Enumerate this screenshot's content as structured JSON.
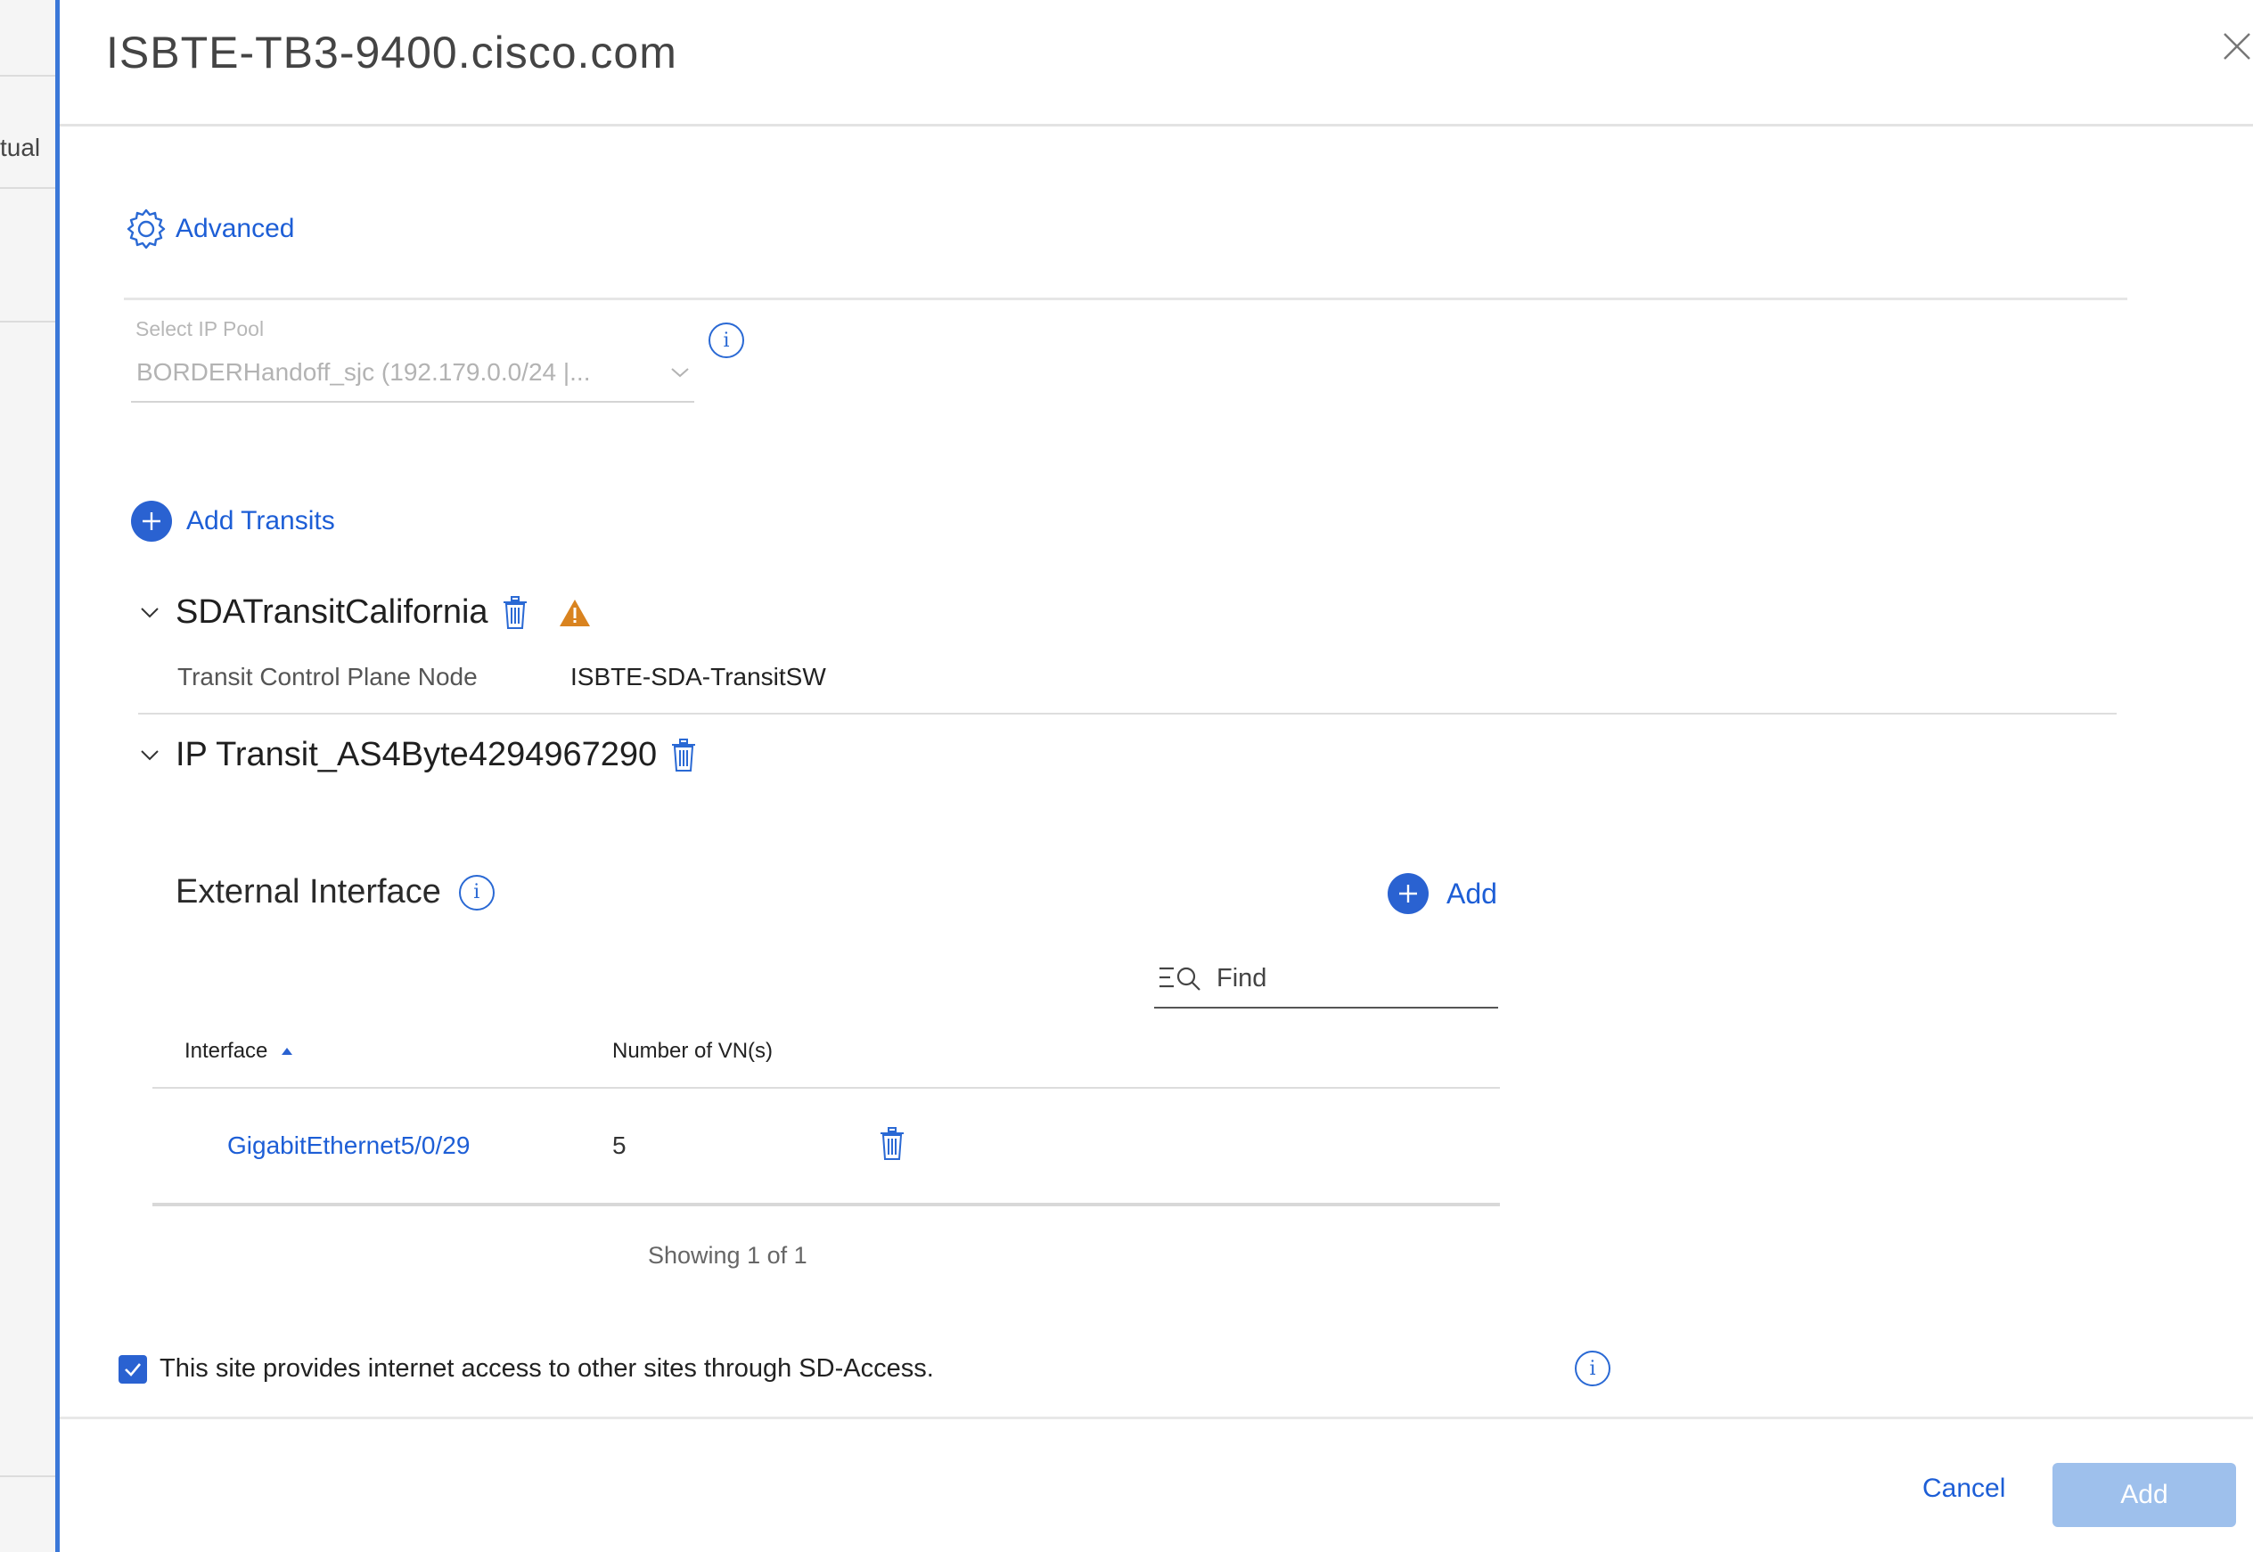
{
  "background": {
    "partial_text": "tual"
  },
  "drawer": {
    "title": "ISBTE-TB3-9400.cisco.com"
  },
  "advanced": {
    "label": "Advanced"
  },
  "ip_pool": {
    "label": "Select IP Pool",
    "value": "BORDERHandoff_sjc (192.179.0.0/24 |..."
  },
  "add_transits": {
    "label": "Add Transits"
  },
  "transits": [
    {
      "name": "SDATransitCalifornia",
      "control_plane_label": "Transit Control Plane Node",
      "control_plane_value": "ISBTE-SDA-TransitSW",
      "warning": true
    },
    {
      "name": "IP Transit_AS4Byte4294967290"
    }
  ],
  "external_interface": {
    "title": "External Interface",
    "add_label": "Add",
    "find_placeholder": "Find",
    "columns": [
      "Interface",
      "Number of VN(s)"
    ],
    "rows": [
      {
        "interface": "GigabitEthernet5/0/29",
        "vn_count": "5"
      }
    ],
    "showing": "Showing 1 of 1"
  },
  "internet_access": {
    "label": "This site provides internet access to other sites through SD-Access.",
    "checked": true
  },
  "footer": {
    "cancel_label": "Cancel",
    "add_label": "Add"
  },
  "colors": {
    "accent": "#2A62D1",
    "drawer_border": "#3B78D8",
    "warning": "#D9831F",
    "disabled_button": "#9EC0EC"
  }
}
